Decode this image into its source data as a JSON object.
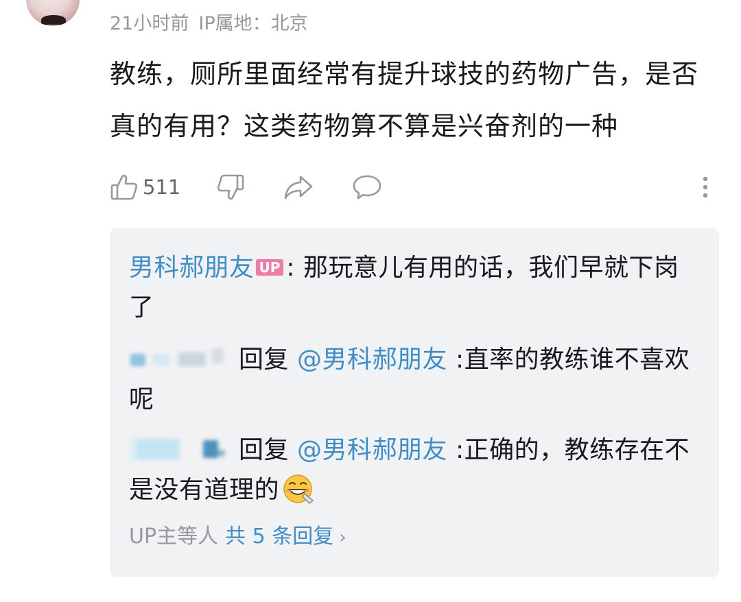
{
  "comment": {
    "time": "21小时前",
    "ip": "IP属地：北京",
    "text": "教练，厕所里面经常有提升球技的药物广告，是否真的有用？这类药物算不算是兴奋剂的一种",
    "likes": "511"
  },
  "actions": {
    "like_icon": "thumb-up-icon",
    "dislike_icon": "thumb-down-icon",
    "share_icon": "share-icon",
    "reply_icon": "comment-bubble-icon",
    "more_icon": "more-vertical-icon"
  },
  "replies": [
    {
      "user": "男科郝朋友",
      "badge": "UP",
      "text": ": 那玩意儿有用的话，我们早就下岗了"
    },
    {
      "reply_word": "回复",
      "mention": "@男科郝朋友",
      "text": ":直率的教练谁不喜欢呢"
    },
    {
      "reply_word": "回复",
      "mention": "@男科郝朋友",
      "text": ":正确的，教练存在不是没有道理的",
      "emoji": "grinning-emoji-icon"
    }
  ],
  "more_replies": {
    "prefix": "UP主等人",
    "link": "共 5 条回复"
  },
  "colors": {
    "link_blue": "#3e8ec9",
    "muted_gray": "#9499a0",
    "reply_bg": "#f1f2f3",
    "up_badge": "#f27ba6"
  }
}
